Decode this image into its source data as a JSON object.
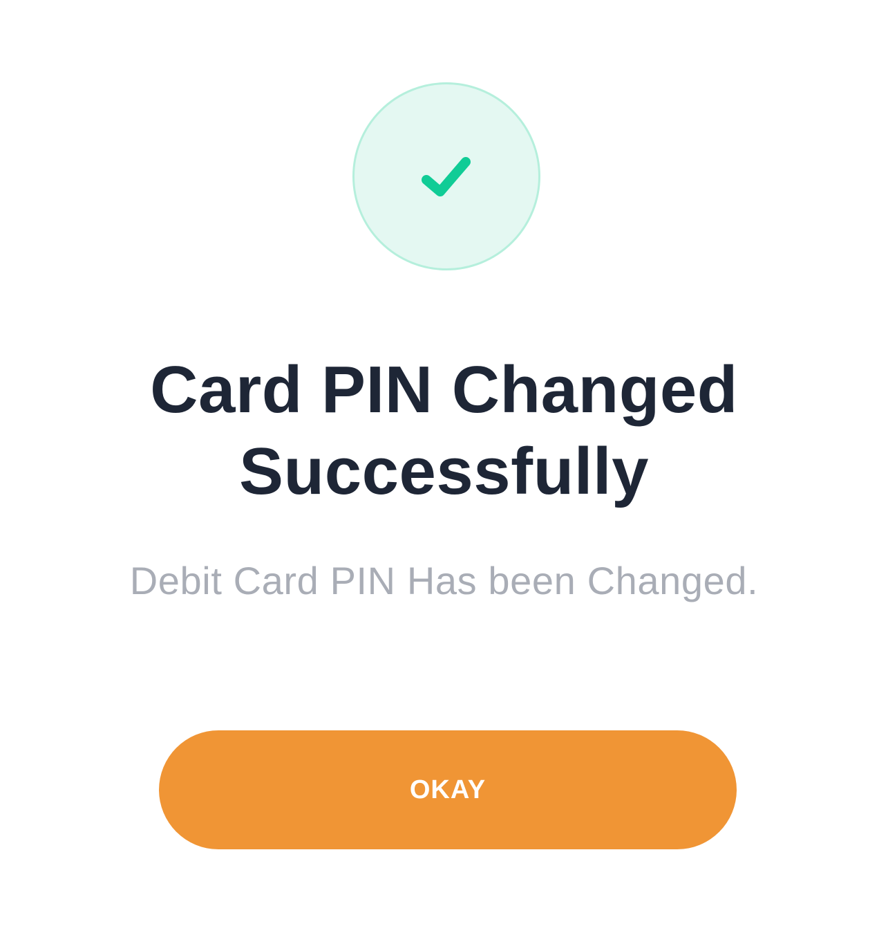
{
  "dialog": {
    "icon": "checkmark-icon",
    "title_line1": "Card PIN Changed",
    "title_line2": "Successfully",
    "message": "Debit Card PIN Has been Changed.",
    "button_label": "OKAY"
  },
  "colors": {
    "background": "#ffffff",
    "success_circle_fill": "#e4f8f2",
    "success_circle_border": "#b5efdc",
    "checkmark": "#10cc96",
    "title_text": "#1e2636",
    "message_text": "#a9adb6",
    "button_background": "#f09535",
    "button_text": "#ffffff"
  }
}
